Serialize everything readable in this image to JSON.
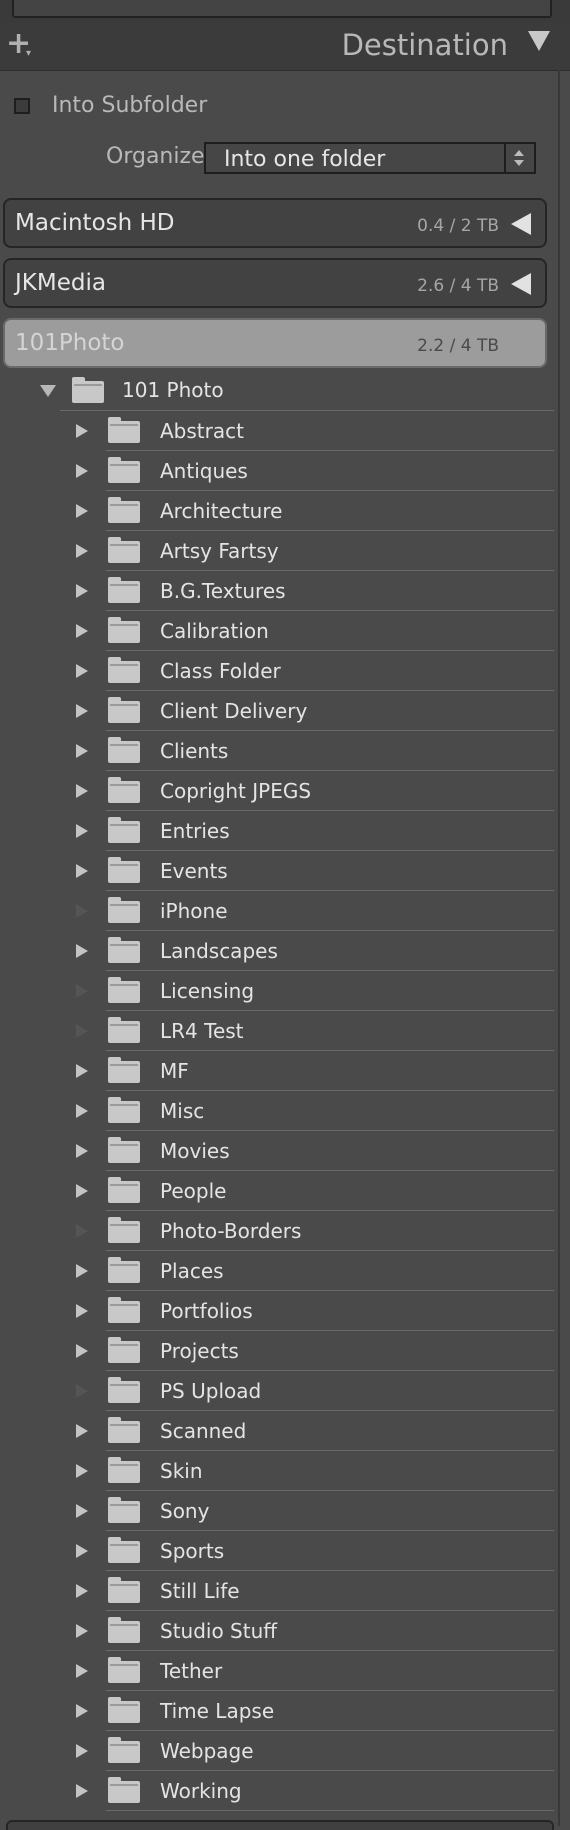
{
  "header": {
    "title": "Destination",
    "plus_icon": "plus-icon",
    "collapse_icon": "triangle-down-icon"
  },
  "subfolder": {
    "label": "Into Subfolder",
    "checked": false
  },
  "organize": {
    "label": "Organize",
    "value": "Into one folder"
  },
  "volumes": [
    {
      "name": "Macintosh HD",
      "size": "0.4 / 2 TB",
      "state": "collapsed"
    },
    {
      "name": "JKMedia",
      "size": "2.6 / 4 TB",
      "state": "collapsed"
    },
    {
      "name": "101Photo",
      "size": "2.2 / 4 TB",
      "state": "expanded"
    }
  ],
  "root_folder": {
    "label": "101 Photo"
  },
  "folders": [
    {
      "label": "Abstract",
      "has_children": true
    },
    {
      "label": "Antiques",
      "has_children": true
    },
    {
      "label": "Architecture",
      "has_children": true
    },
    {
      "label": "Artsy Fartsy",
      "has_children": true
    },
    {
      "label": "B.G.Textures",
      "has_children": true
    },
    {
      "label": "Calibration",
      "has_children": true
    },
    {
      "label": "Class Folder",
      "has_children": true
    },
    {
      "label": "Client Delivery",
      "has_children": true
    },
    {
      "label": "Clients",
      "has_children": true
    },
    {
      "label": "Copright JPEGS",
      "has_children": true
    },
    {
      "label": "Entries",
      "has_children": true
    },
    {
      "label": "Events",
      "has_children": true
    },
    {
      "label": "iPhone",
      "has_children": false
    },
    {
      "label": "Landscapes",
      "has_children": true
    },
    {
      "label": "Licensing",
      "has_children": false
    },
    {
      "label": "LR4 Test",
      "has_children": false
    },
    {
      "label": "MF",
      "has_children": true
    },
    {
      "label": "Misc",
      "has_children": true
    },
    {
      "label": "Movies",
      "has_children": true
    },
    {
      "label": "People",
      "has_children": true
    },
    {
      "label": "Photo-Borders",
      "has_children": false
    },
    {
      "label": "Places",
      "has_children": true
    },
    {
      "label": "Portfolios",
      "has_children": true
    },
    {
      "label": "Projects",
      "has_children": true
    },
    {
      "label": "PS Upload",
      "has_children": false
    },
    {
      "label": "Scanned",
      "has_children": true
    },
    {
      "label": "Skin",
      "has_children": true
    },
    {
      "label": "Sony",
      "has_children": true
    },
    {
      "label": "Sports",
      "has_children": true
    },
    {
      "label": "Still Life",
      "has_children": true
    },
    {
      "label": "Studio Stuff",
      "has_children": true
    },
    {
      "label": "Tether",
      "has_children": true
    },
    {
      "label": "Time Lapse",
      "has_children": true
    },
    {
      "label": "Webpage",
      "has_children": true
    },
    {
      "label": "Working",
      "has_children": true
    }
  ]
}
